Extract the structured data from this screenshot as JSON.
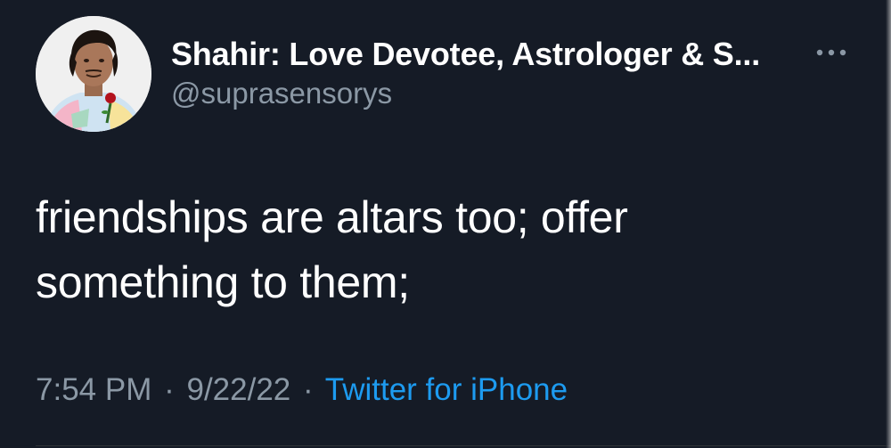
{
  "author": {
    "display_name": "Shahir: Love Devotee, Astrologer & S...",
    "handle": "@suprasensorys",
    "avatar_icon": "person-photo-avatar"
  },
  "tweet": {
    "text_lines": [
      "friendships are altars too; offer",
      "something to them;"
    ]
  },
  "meta": {
    "time": "7:54 PM",
    "separator": "·",
    "date": "9/22/22",
    "source": "Twitter for iPhone"
  },
  "colors": {
    "background": "#151b26",
    "primary_text": "#ffffff",
    "secondary_text": "#8b98a5",
    "link": "#1d9bf0"
  },
  "icons": {
    "more": "more-horizontal-icon"
  }
}
